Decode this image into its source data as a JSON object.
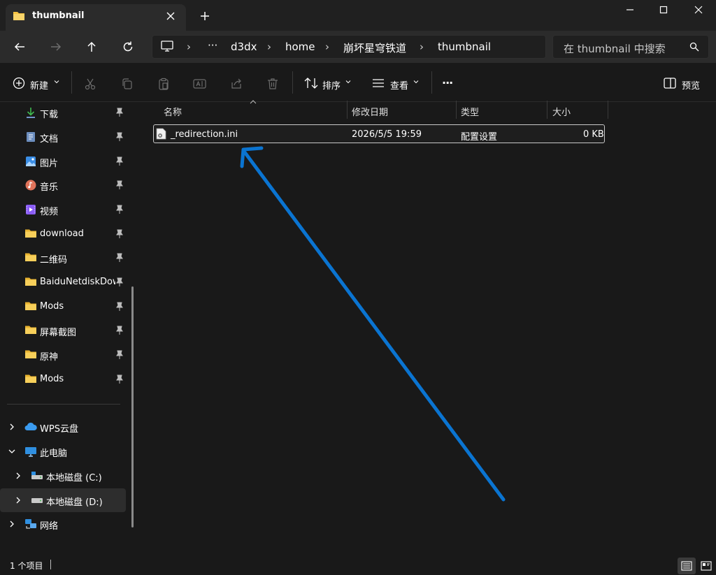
{
  "colors": {
    "accent": "#0078d4",
    "folder": "#f6c342",
    "arrow": "#0a74d1",
    "selection_border": "#c8c8c8"
  },
  "window": {
    "tab_title": "thumbnail",
    "tab_icon": "folder-icon",
    "controls": [
      "minimize-icon",
      "maximize-icon",
      "close-icon"
    ]
  },
  "nav": {
    "breadcrumb": [
      "d3dx",
      "home",
      "崩坏星穹铁道",
      "thumbnail"
    ],
    "overflow": "···",
    "search_placeholder": "在 thumbnail 中搜索"
  },
  "toolbar": {
    "new_label": "新建",
    "sort_label": "排序",
    "view_label": "查看",
    "more_label": "···",
    "preview_label": "预览",
    "icons": [
      "cut-icon",
      "copy-icon",
      "paste-icon",
      "rename-icon",
      "share-icon",
      "delete-icon"
    ]
  },
  "sidebar": {
    "quick_access": [
      {
        "label": "下载",
        "icon": "download-icon"
      },
      {
        "label": "文档",
        "icon": "document-icon"
      },
      {
        "label": "图片",
        "icon": "pictures-icon"
      },
      {
        "label": "音乐",
        "icon": "music-icon"
      },
      {
        "label": "视频",
        "icon": "video-icon"
      },
      {
        "label": "download",
        "icon": "folder-icon"
      },
      {
        "label": "二维码",
        "icon": "folder-icon"
      },
      {
        "label": "BaiduNetdiskDownload",
        "icon": "folder-icon"
      },
      {
        "label": "Mods",
        "icon": "folder-icon"
      },
      {
        "label": "屏幕截图",
        "icon": "folder-icon"
      },
      {
        "label": "原神",
        "icon": "folder-icon"
      },
      {
        "label": "Mods",
        "icon": "folder-icon"
      }
    ],
    "tree": [
      {
        "label": "WPS云盘",
        "icon": "cloud-icon"
      },
      {
        "label": "此电脑",
        "icon": "computer-icon"
      },
      {
        "label": "本地磁盘 (C:)",
        "icon": "drive-icon"
      },
      {
        "label": "本地磁盘 (D:)",
        "icon": "drive-icon"
      },
      {
        "label": "网络",
        "icon": "network-icon"
      }
    ]
  },
  "filelist": {
    "columns": [
      "名称",
      "修改日期",
      "类型",
      "大小"
    ],
    "rows": [
      {
        "name": "_redirection.ini",
        "date": "2026/5/5 19:59",
        "type": "配置设置",
        "size": "0 KB"
      }
    ]
  },
  "status": {
    "count": "1 个项目"
  }
}
